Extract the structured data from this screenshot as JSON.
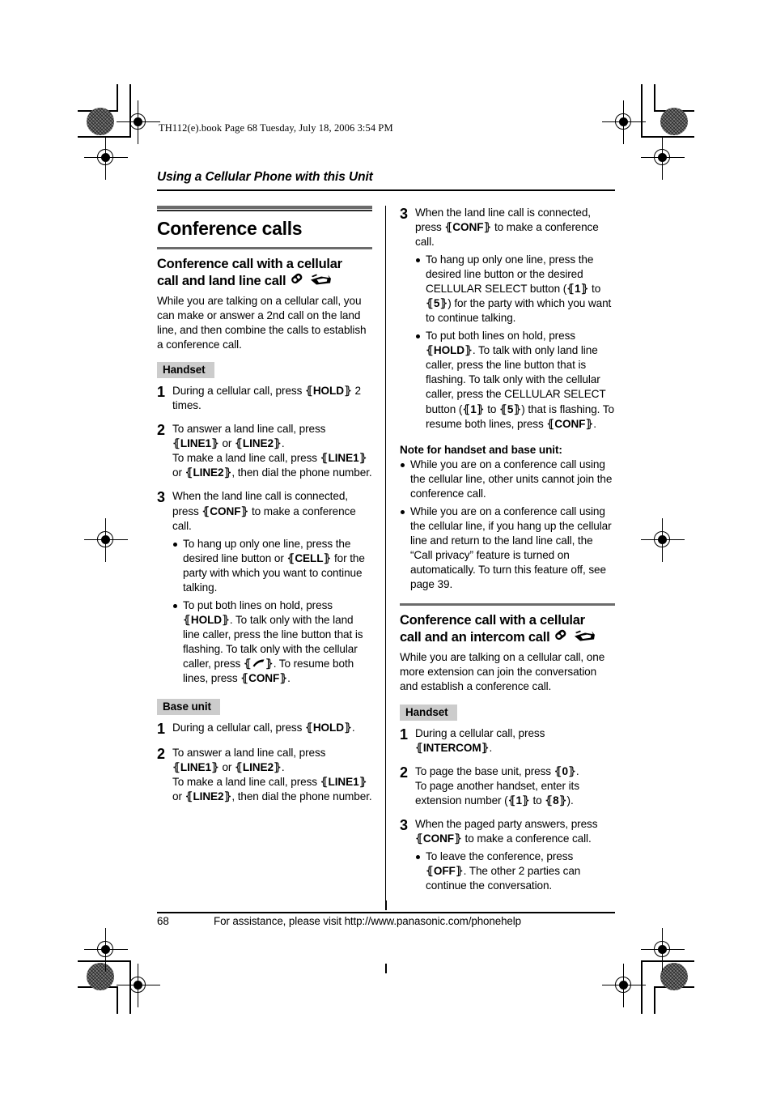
{
  "printer_slug": "TH112(e).book  Page 68  Tuesday, July 18, 2006  3:54 PM",
  "running_head": "Using a Cellular Phone with this Unit",
  "footer": {
    "page_number": "68",
    "assistance_text": "For assistance, please visit http://www.panasonic.com/phonehelp"
  },
  "colors": {
    "rule_dark": "#2b2b2b",
    "rule_gray": "#6b6b6b",
    "tag_background": "#cccccc",
    "text": "#000000"
  },
  "section": {
    "title": "Conference calls"
  },
  "left_column": {
    "heading": {
      "line1": "Conference call with a cellular",
      "line2": "call and land line call",
      "icons": [
        "handset-icon",
        "base-unit-icon"
      ]
    },
    "intro": "While you are talking on a cellular call, you can make or answer a 2nd call on the land line, and then combine the calls to establish a conference call.",
    "handset_tag": "Handset",
    "handset_steps": [
      {
        "number": "1",
        "parts": [
          {
            "t": "During a cellular call, press "
          },
          {
            "k": "HOLD"
          },
          {
            "t": " 2 times."
          }
        ],
        "bullets": []
      },
      {
        "number": "2",
        "parts": [
          {
            "t": "To answer a land line call, press "
          },
          {
            "k": "LINE1"
          },
          {
            "t": " or "
          },
          {
            "k": "LINE2"
          },
          {
            "t": "."
          },
          {
            "br": true
          },
          {
            "t": "To make a land line call, press "
          },
          {
            "k": "LINE1"
          },
          {
            "t": " or "
          },
          {
            "k": "LINE2"
          },
          {
            "t": ", then dial the phone number."
          }
        ],
        "bullets": []
      },
      {
        "number": "3",
        "parts": [
          {
            "t": "When the land line call is connected, press "
          },
          {
            "k": "CONF"
          },
          {
            "t": " to make a conference call."
          }
        ],
        "bullets": [
          [
            {
              "t": "To hang up only one line, press the desired line button or "
            },
            {
              "k": "CELL"
            },
            {
              "t": " for the party with which you want to continue talking."
            }
          ],
          [
            {
              "t": "To put both lines on hold, press "
            },
            {
              "k": "HOLD"
            },
            {
              "t": ". To talk only with the land line caller, press the line button that is flashing. To talk only with the cellular caller, press "
            },
            {
              "kicon": "talk-handset-icon"
            },
            {
              "t": ". To resume both lines, press "
            },
            {
              "k": "CONF"
            },
            {
              "t": "."
            }
          ]
        ]
      }
    ],
    "base_unit_tag": "Base unit",
    "base_unit_steps": [
      {
        "number": "1",
        "parts": [
          {
            "t": "During a cellular call, press "
          },
          {
            "k": "HOLD"
          },
          {
            "t": "."
          }
        ],
        "bullets": []
      },
      {
        "number": "2",
        "parts": [
          {
            "t": "To answer a land line call, press "
          },
          {
            "k": "LINE1"
          },
          {
            "t": " or "
          },
          {
            "k": "LINE2"
          },
          {
            "t": "."
          },
          {
            "br": true
          },
          {
            "t": "To make a land line call, press "
          },
          {
            "k": "LINE1"
          },
          {
            "t": " or "
          },
          {
            "k": "LINE2"
          },
          {
            "t": ", then dial the phone number."
          }
        ],
        "bullets": []
      }
    ]
  },
  "right_column": {
    "continued_step": {
      "number": "3",
      "parts": [
        {
          "t": "When the land line call is connected, press "
        },
        {
          "k": "CONF"
        },
        {
          "t": " to make a conference call."
        }
      ],
      "bullets": [
        [
          {
            "t": "To hang up only one line, press the desired line button or the desired CELLULAR SELECT button ("
          },
          {
            "k": "1"
          },
          {
            "t": " to "
          },
          {
            "k": "5"
          },
          {
            "t": ") for the party with which you want to continue talking."
          }
        ],
        [
          {
            "t": "To put both lines on hold, press "
          },
          {
            "k": "HOLD"
          },
          {
            "t": ". To talk with only land line caller, press the line button that is flashing. To talk only with the cellular caller, press the CELLULAR SELECT button ("
          },
          {
            "k": "1"
          },
          {
            "t": " to "
          },
          {
            "k": "5"
          },
          {
            "t": ") that is flashing. To resume both lines, press "
          },
          {
            "k": "CONF"
          },
          {
            "t": "."
          }
        ]
      ]
    },
    "note_title": "Note for handset and base unit:",
    "notes": [
      "While you are on a conference call using the cellular line, other units cannot join the conference call.",
      "While you are on a conference call using the cellular line, if you hang up the cellular line and return to the land line call, the “Call privacy” feature is turned on automatically. To turn this feature off, see page 39."
    ],
    "heading": {
      "line1": "Conference call with a cellular",
      "line2": "call and an intercom call",
      "icons": [
        "handset-icon",
        "base-unit-icon"
      ]
    },
    "intro": "While you are talking on a cellular call, one more extension can join the conversation and establish a conference call.",
    "handset_tag": "Handset",
    "handset_steps": [
      {
        "number": "1",
        "parts": [
          {
            "t": "During a cellular call, press "
          },
          {
            "k": "INTERCOM"
          },
          {
            "t": "."
          }
        ],
        "bullets": []
      },
      {
        "number": "2",
        "parts": [
          {
            "t": "To page the base unit, press "
          },
          {
            "k": "0"
          },
          {
            "t": "."
          },
          {
            "br": true
          },
          {
            "t": "To page another handset, enter its extension number ("
          },
          {
            "k": "1"
          },
          {
            "t": " to "
          },
          {
            "k": "8"
          },
          {
            "t": ")."
          }
        ],
        "bullets": []
      },
      {
        "number": "3",
        "parts": [
          {
            "t": "When the paged party answers, press "
          },
          {
            "k": "CONF"
          },
          {
            "t": " to make a conference call."
          }
        ],
        "bullets": [
          [
            {
              "t": "To leave the conference, press "
            },
            {
              "k": "OFF"
            },
            {
              "t": ". The other 2 parties can continue the conversation."
            }
          ]
        ]
      }
    ]
  }
}
